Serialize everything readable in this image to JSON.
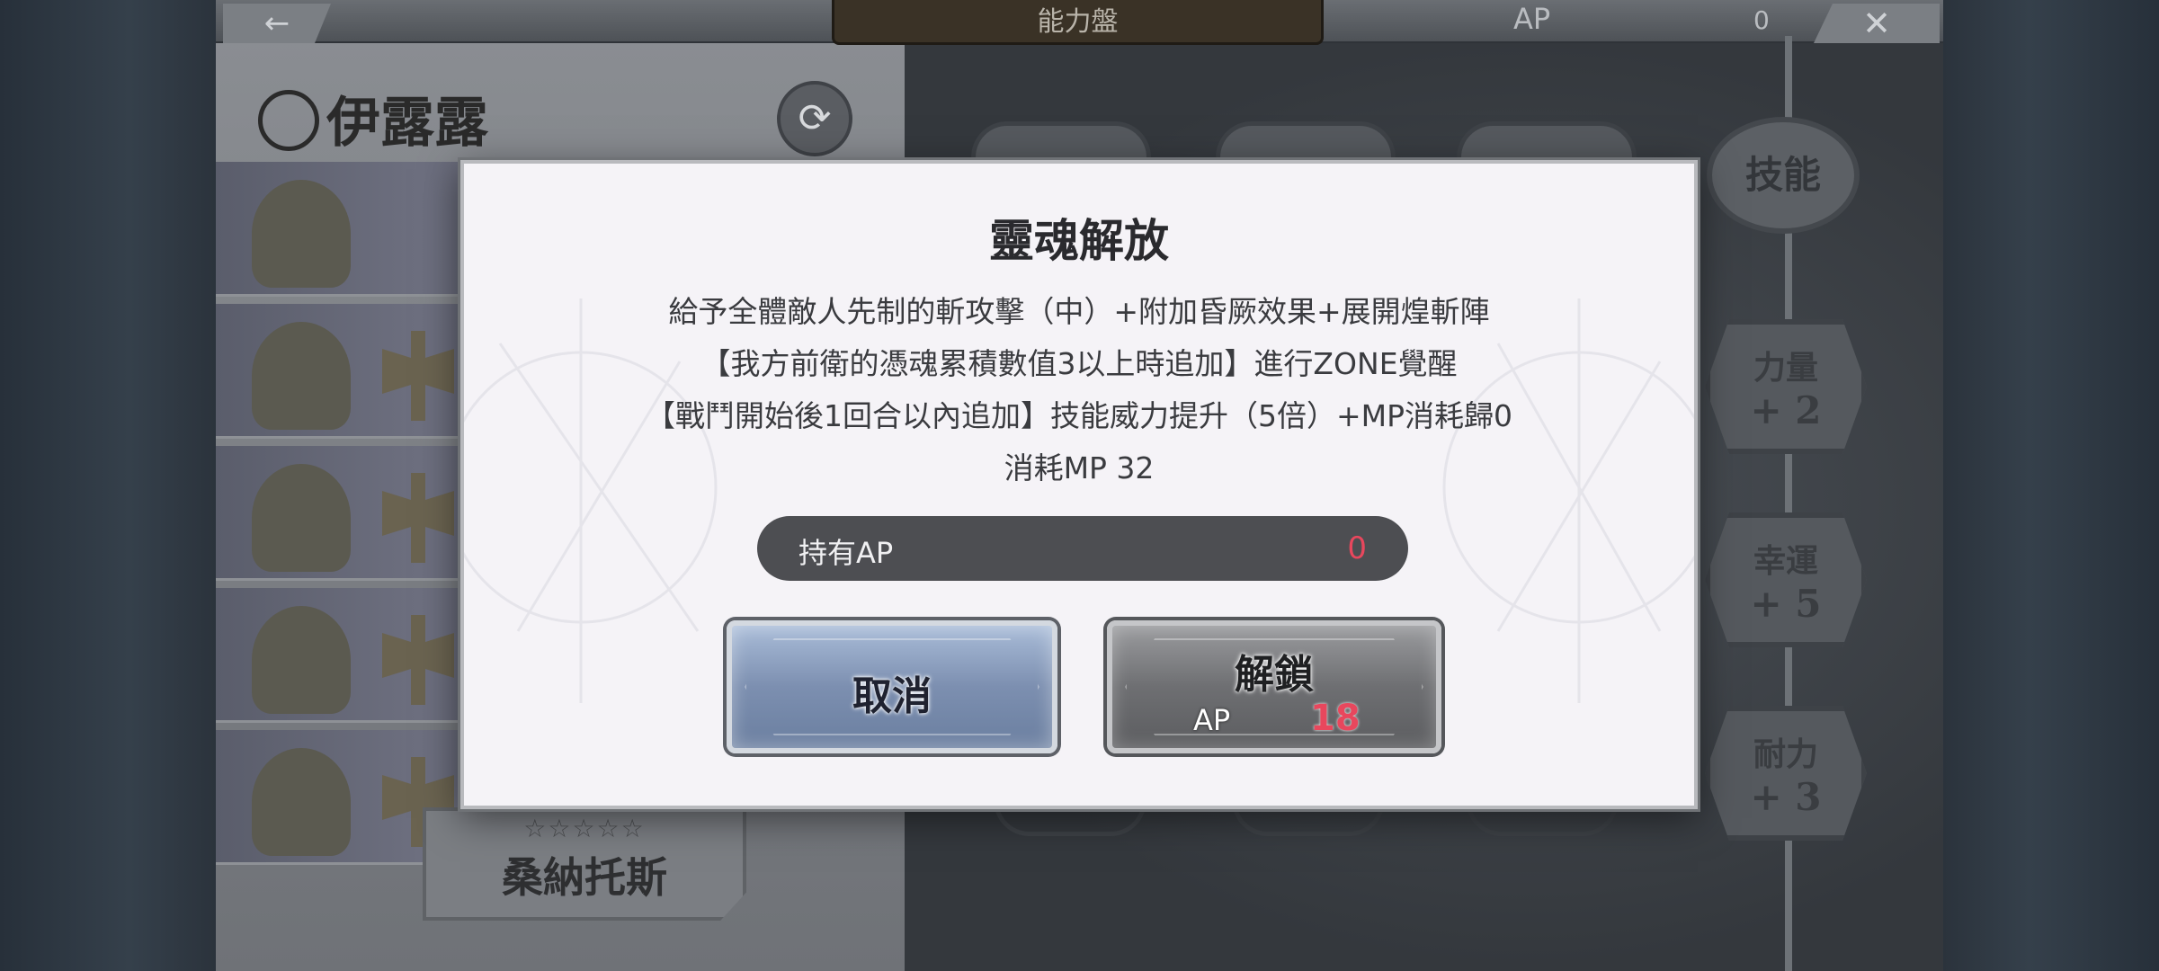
{
  "top_bar": {
    "back_icon": "←",
    "title": "能力盤",
    "ap_label": "AP",
    "ap_value": "0",
    "close_icon": "✕"
  },
  "character": {
    "name": "伊露露",
    "swap_icon": "⟳"
  },
  "bottom_card": {
    "stars": "☆☆☆☆☆",
    "name": "桑納托斯"
  },
  "skill_tree": {
    "skill_badge": "技能",
    "nodes": [
      {
        "title": "力量",
        "value": "+ 2"
      },
      {
        "title": "幸運",
        "value": "+ 5"
      },
      {
        "title": "耐力",
        "value": "+ 3"
      }
    ]
  },
  "modal": {
    "title": "靈魂解放",
    "description": [
      "給予全體敵人先制的斬攻擊（中）+附加昏厥效果+展開煌斬陣",
      "【我方前衛的憑魂累積數值3以上時追加】進行ZONE覺醒",
      "【戰鬥開始後1回合以內追加】技能威力提升（5倍）+MP消耗歸0",
      "消耗MP 32"
    ],
    "ap_bar": {
      "label": "持有AP",
      "value": "0"
    },
    "cancel_button": "取消",
    "unlock_button": {
      "label": "解鎖",
      "ap_label": "AP",
      "cost": "18"
    }
  },
  "colors": {
    "accent_red": "#e8475d",
    "modal_bg": "#f5f3f7",
    "ap_bar_bg": "#4d4e52"
  }
}
